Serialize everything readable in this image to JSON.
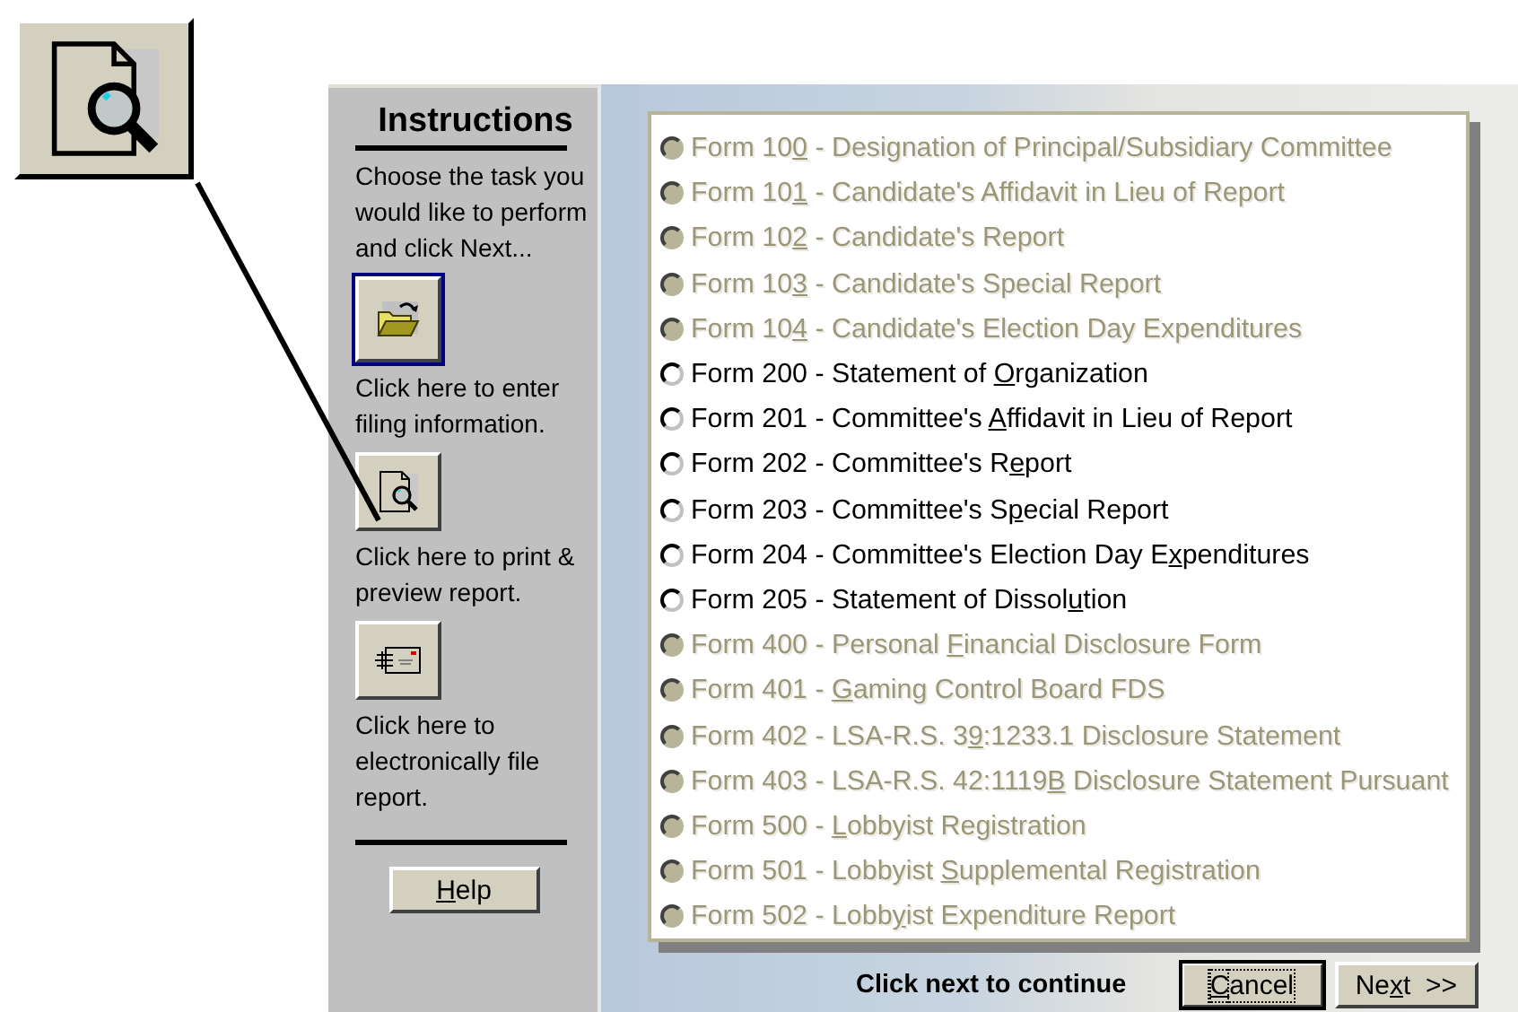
{
  "instructions": {
    "title": "Instructions",
    "intro": "Choose the task you would like to perform and click Next...",
    "actions": [
      {
        "kind": "open",
        "caption": "Click here to enter filing information.",
        "selected": true
      },
      {
        "kind": "preview",
        "caption": "Click here to print & preview report.",
        "selected": false
      },
      {
        "kind": "efile",
        "caption": "Click here to electronically file report.",
        "selected": false
      }
    ],
    "help_button": {
      "key": "H",
      "after": "elp"
    }
  },
  "forms": [
    {
      "before": "Form 10",
      "key": "0",
      "after": " - Designation of Principal/Subsidiary Committee",
      "disabled": true
    },
    {
      "before": "Form 10",
      "key": "1",
      "after": " - Candidate's Affidavit in Lieu of Report",
      "disabled": true
    },
    {
      "before": "Form 10",
      "key": "2",
      "after": " - Candidate's Report",
      "disabled": true
    },
    {
      "before": "Form 10",
      "key": "3",
      "after": " - Candidate's Special Report",
      "disabled": true
    },
    {
      "before": "Form 10",
      "key": "4",
      "after": " - Candidate's Election Day Expenditures",
      "disabled": true
    },
    {
      "before": "Form 200 - Statement of ",
      "key": "O",
      "after": "rganization",
      "disabled": false
    },
    {
      "before": "Form 201 - Committee's ",
      "key": "A",
      "after": "ffidavit in Lieu of Report",
      "disabled": false
    },
    {
      "before": "Form 202 - Committee's R",
      "key": "e",
      "after": "port",
      "disabled": false
    },
    {
      "before": "Form 203 - Committee's S",
      "key": "p",
      "after": "ecial Report",
      "disabled": false
    },
    {
      "before": "Form 204 - Committee's Election Day E",
      "key": "x",
      "after": "penditures",
      "disabled": false
    },
    {
      "before": "Form 205 - Statement of Dissol",
      "key": "u",
      "after": "tion",
      "disabled": false
    },
    {
      "before": "Form 400 - Personal ",
      "key": "F",
      "after": "inancial Disclosure Form",
      "disabled": true
    },
    {
      "before": "Form 401 - ",
      "key": "G",
      "after": "aming Control Board FDS",
      "disabled": true
    },
    {
      "before": "Form 402 - LSA-R.S. 3",
      "key": "9",
      "after": ":1233.1 Disclosure Statement",
      "disabled": true
    },
    {
      "before": "Form 403 - LSA-R.S. 42:1119",
      "key": "B",
      "after": " Disclosure Statement Pursuant",
      "disabled": true
    },
    {
      "before": "Form 500 - ",
      "key": "L",
      "after": "obbyist Registration",
      "disabled": true
    },
    {
      "before": "Form 501 - Lobbyist ",
      "key": "S",
      "after": "upplemental Registration",
      "disabled": true
    },
    {
      "before": "Form 502 - Lobb",
      "key": "y",
      "after": "ist Expenditure Report",
      "disabled": true
    }
  ],
  "footer": {
    "hint": "Click next to continue",
    "buttons": [
      {
        "key": "C",
        "after": "ancel",
        "focused": true
      },
      {
        "before": "Ne",
        "key": "x",
        "after": "t  >>",
        "focused": false
      }
    ]
  }
}
